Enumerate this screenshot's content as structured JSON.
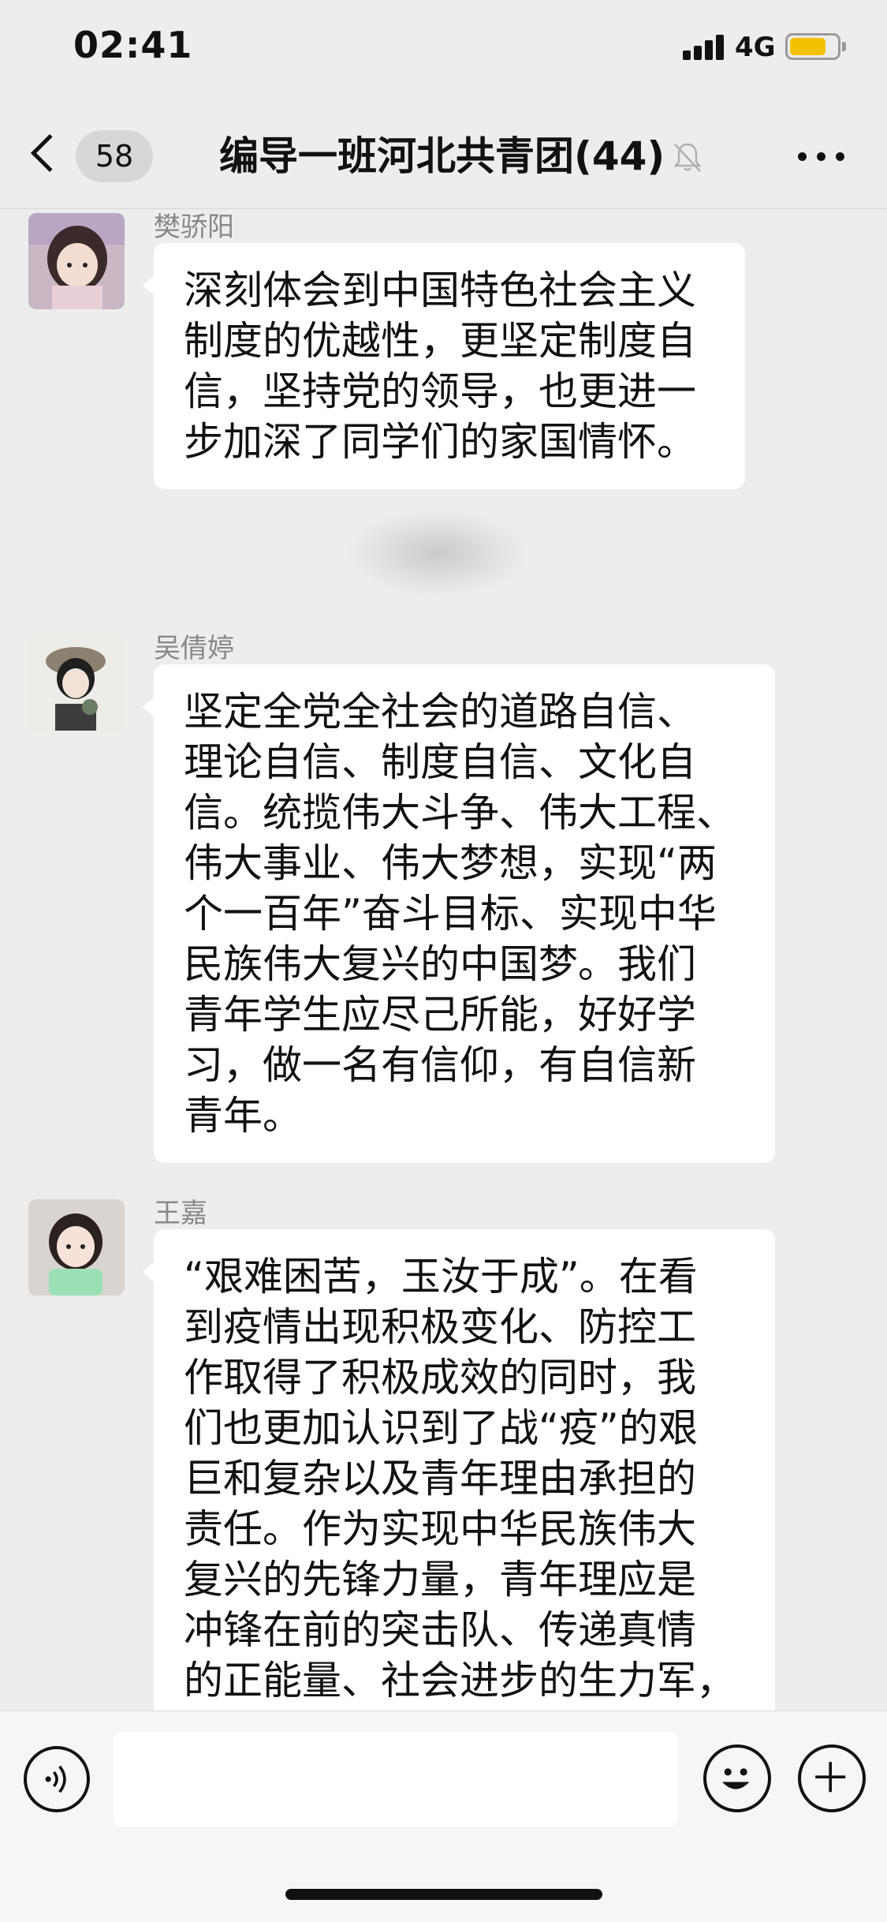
{
  "status_bar": {
    "time": "02:41",
    "network": "4G",
    "battery_level": 0.78,
    "battery_color": "#f2c200"
  },
  "nav": {
    "unread_count": "58",
    "title": "编导一班河北共青团(44)",
    "back_icon": "chevron-left-icon",
    "mute_icon": "bell-muted-icon",
    "more_icon": "ellipsis-icon"
  },
  "messages": [
    {
      "sender": "樊骄阳",
      "lines": [
        "深刻体会到中国特色社会主义",
        "制度的优越性，更坚定制度自",
        "信，坚持党的领导，也更进一",
        "步加深了同学们的家国情怀。"
      ]
    },
    {
      "sender": "吴倩婷",
      "lines": [
        "坚定全党全社会的道路自信、",
        "理论自信、制度自信、文化自",
        "信。统揽伟大斗争、伟大工程、",
        "伟大事业、伟大梦想，实现“两",
        "个一百年”奋斗目标、实现中华",
        "民族伟大复兴的中国梦。我们",
        "青年学生应尽己所能，好好学",
        "习，做一名有信仰，有自信新",
        "青年。"
      ]
    },
    {
      "sender": "王嘉",
      "lines": [
        "“艰难困苦，玉汝于成”。在看",
        "到疫情出现积极变化、防控工",
        "作取得了积极成效的同时，我",
        "们也更加认识到了战“疫”的艰",
        "巨和复杂以及青年理由承担的",
        "责任。作为实现中华民族伟大",
        "复兴的先锋力量，青年理应是",
        "冲锋在前的突击队、传递真情",
        "的正能量、社会进步的生力军，"
      ]
    }
  ],
  "input_bar": {
    "voice_icon": "voice-icon",
    "emoji_icon": "emoji-icon",
    "add_icon": "plus-icon",
    "input_value": ""
  }
}
